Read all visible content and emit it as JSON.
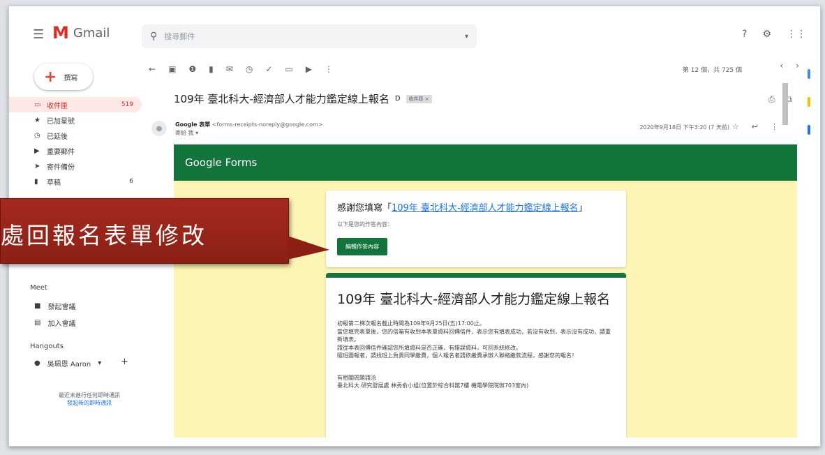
{
  "header": {
    "app_name": "Gmail",
    "search_placeholder": "搜尋郵件"
  },
  "sidebar": {
    "compose_label": "撰寫",
    "items": [
      {
        "label": "收件匣",
        "count": "519",
        "icon": "inbox-icon"
      },
      {
        "label": "已加星號",
        "count": "",
        "icon": "star-icon"
      },
      {
        "label": "已延後",
        "count": "",
        "icon": "clock-icon"
      },
      {
        "label": "重要郵件",
        "count": "",
        "icon": "important-icon"
      },
      {
        "label": "寄件備份",
        "count": "",
        "icon": "sent-icon"
      },
      {
        "label": "草稿",
        "count": "6",
        "icon": "draft-icon"
      }
    ],
    "meet": {
      "title": "Meet",
      "items": [
        "發起會議",
        "加入會議"
      ]
    },
    "hangouts": {
      "title": "Hangouts",
      "user": "吳珮恩 Aaron",
      "empty_text": "最近未進行任何即時通訊",
      "start_link": "發起新的即時通訊"
    }
  },
  "toolbar": {
    "pager": "第 12 個，共 725 個"
  },
  "email": {
    "subject": "109年 臺北科大-經濟部人才能力鑑定線上報名",
    "label_chip": "收件匣 ×",
    "sender_name": "Google 表單",
    "sender_email": "<forms-receipts-noreply@google.com>",
    "to": "寄給 我",
    "date": "2020年9月18日 下午3:20 (7 天前)"
  },
  "body": {
    "forms_brand": "Google Forms",
    "thanks_prefix": "感謝您填寫「",
    "thanks_link": "109年 臺北科大-經濟部人才能力鑑定線上報名",
    "thanks_suffix": "」",
    "copy_label": "以下是您的作答內容：",
    "edit_button": "編輯作答內容",
    "form_title": "109年 臺北科大-經濟部人才能力鑑定線上報名",
    "desc_lines": [
      "初級第二梯次報名截止時間為109年9月25日(五)17:00止。",
      "當您填完表單後，您的信箱有收到本表單資料回傳信件，表示您有填表成功，若沒有收到，表示沒有成功，請重新填表。",
      "請從本表回傳信件確認您所填資料是否正確，有錯誤資料，可回系統修改。",
      "隨班團報者，請找班上負責同學繳費，個人報名者請依繳費承辦人聯絡繳款流程，感謝您的報名！"
    ],
    "contact_title": "有相關問題請洽",
    "contact_line": "臺北科大 研究發展處 林秀俞小姐(位置於綜合科館7樓 機電學院院辦703室內)"
  },
  "callout": {
    "text": "處回報名表單修改"
  },
  "colors": {
    "forms_green": "#13743c",
    "body_yellow": "#fdf5b5",
    "gmail_red": "#d93025",
    "callout_red": "#a52a1e"
  }
}
